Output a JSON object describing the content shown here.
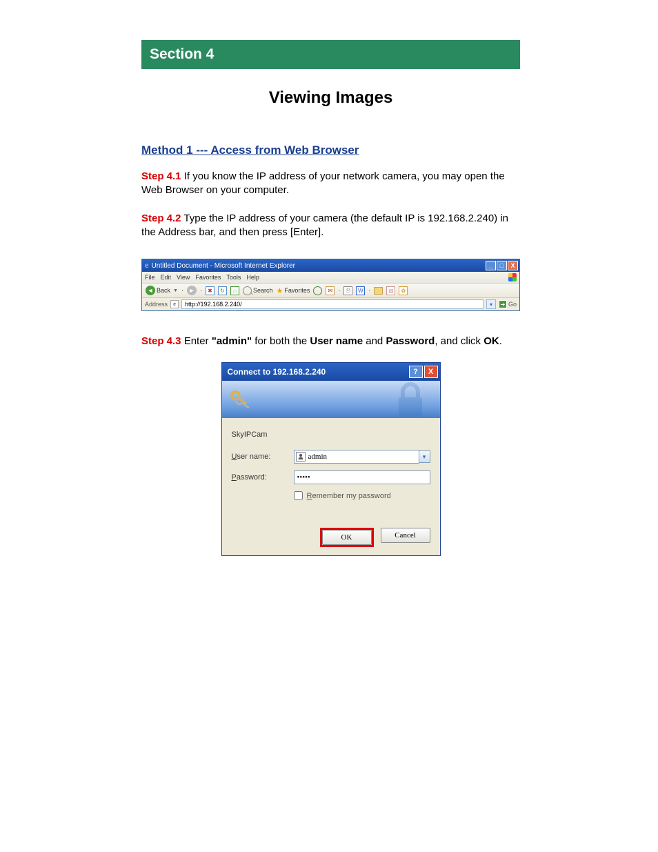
{
  "section_banner": "Section 4",
  "page_title": "Viewing Images",
  "method_heading": "Method 1 --- Access from Web Browser",
  "steps": {
    "s41": {
      "label": "Step 4.1",
      "text": " If you know the IP address of your network camera, you may open the Web Browser on your computer."
    },
    "s42": {
      "label": "Step 4.2",
      "text": " Type the IP address of your camera (the default IP is 192.168.2.240) in the Address bar, and then press [Enter]."
    },
    "s43": {
      "label": "Step 4.3",
      "pre": " Enter ",
      "admin_quoted": "\"admin\"",
      "mid1": " for both the ",
      "user_name_b": "User name",
      "mid2": " and ",
      "password_b": "Password",
      "mid3": ", and click ",
      "ok_b": "OK",
      "tail": "."
    }
  },
  "ie": {
    "title": "Untitled Document - Microsoft Internet Explorer",
    "menus": [
      "File",
      "Edit",
      "View",
      "Favorites",
      "Tools",
      "Help"
    ],
    "back": "Back",
    "search": "Search",
    "favorites": "Favorites",
    "address_label": "Address",
    "address_value": "http://192.168.2.240/",
    "go": "Go"
  },
  "dialog": {
    "title": "Connect to 192.168.2.240",
    "realm": "SkyIPCam",
    "user_label_u": "U",
    "user_label_rest": "ser name:",
    "pass_label_u": "P",
    "pass_label_rest": "assword:",
    "user_value": "admin",
    "pass_value": "•••••",
    "remember_u": "R",
    "remember_rest": "emember my password",
    "ok": "OK",
    "cancel": "Cancel"
  }
}
